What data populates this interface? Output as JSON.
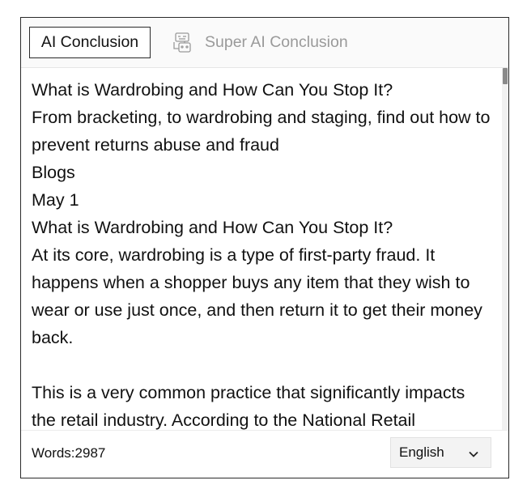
{
  "tabs": {
    "active_label": "AI Conclusion",
    "super_label": "Super AI Conclusion"
  },
  "content": {
    "lines": [
      "What is Wardrobing and How Can You Stop It?",
      "From bracketing, to wardrobing and staging, find out how to prevent returns abuse and fraud",
      "Blogs",
      "May 1",
      "What is Wardrobing and How Can You Stop It?",
      "At its core, wardrobing is a type of first-party fraud. It happens when a shopper buys any item that they wish to wear or use just once, and then return it to get their money back."
    ],
    "paragraph2": "This is a very common practice that significantly impacts the retail industry. According to the National Retail"
  },
  "footer": {
    "word_count": "Words:2987",
    "language": "English"
  },
  "icons": {
    "super_tab_icon": "robot-document-icon",
    "language_chevron": "chevron-down-icon"
  }
}
